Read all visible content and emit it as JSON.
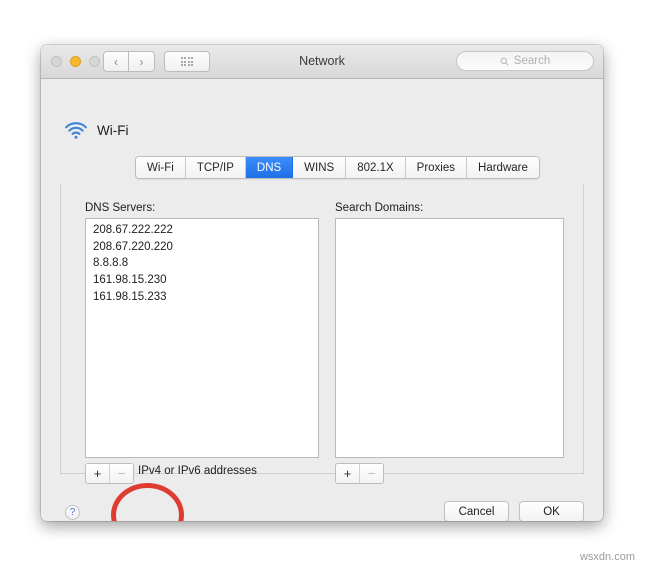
{
  "window": {
    "title": "Network",
    "traffic_lights": [
      {
        "name": "close",
        "state": "disabled"
      },
      {
        "name": "minimize",
        "state": "enabled",
        "color": "#f5b82e"
      },
      {
        "name": "zoom",
        "state": "disabled"
      }
    ],
    "nav": {
      "back": "‹",
      "forward": "›"
    },
    "grid_button": "show-all",
    "search": {
      "placeholder": "Search",
      "value": ""
    }
  },
  "service": {
    "icon": "wifi-icon",
    "name": "Wi-Fi"
  },
  "tabs": [
    {
      "label": "Wi-Fi",
      "active": false
    },
    {
      "label": "TCP/IP",
      "active": false
    },
    {
      "label": "DNS",
      "active": true
    },
    {
      "label": "WINS",
      "active": false
    },
    {
      "label": "802.1X",
      "active": false
    },
    {
      "label": "Proxies",
      "active": false
    },
    {
      "label": "Hardware",
      "active": false
    }
  ],
  "dns": {
    "label": "DNS Servers:",
    "servers": [
      "208.67.222.222",
      "208.67.220.220",
      "8.8.8.8",
      "161.98.15.230",
      "161.98.15.233"
    ],
    "add_label": "+",
    "remove_label": "−",
    "hint": "IPv4 or IPv6 addresses"
  },
  "search_domains": {
    "label": "Search Domains:",
    "domains": [],
    "add_label": "+",
    "remove_label": "−"
  },
  "footer": {
    "help_label": "?",
    "cancel_label": "Cancel",
    "ok_label": "OK"
  },
  "annotation": {
    "shape": "ellipse",
    "color": "#e03b30",
    "target": "dns-add-remove-stepper"
  },
  "watermark": "wsxdn.com"
}
